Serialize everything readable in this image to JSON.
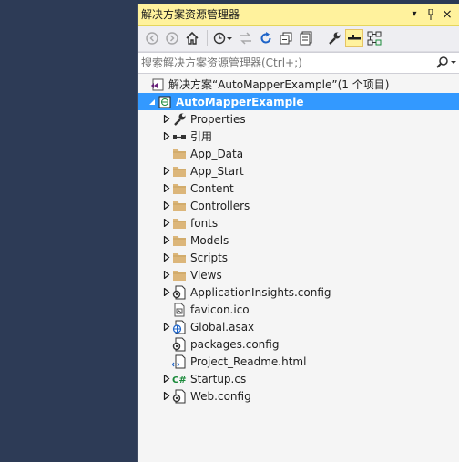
{
  "panel": {
    "title": "解决方案资源管理器",
    "controls": {
      "dropdown": "▾",
      "pin": "⊥",
      "close": "×"
    }
  },
  "toolbar": {
    "buttons": [
      "back-icon",
      "forward-icon",
      "home-icon",
      "history-icon",
      "sync-icon",
      "refresh-icon",
      "collapse-all-icon",
      "show-all-files-icon",
      "properties-icon",
      "preview-icon",
      "class-view-icon"
    ]
  },
  "search": {
    "placeholder": "搜索解决方案资源管理器(Ctrl+;)"
  },
  "tree": {
    "solution": "解决方案“AutoMapperExample”(1 个项目)",
    "project": "AutoMapperExample",
    "items": [
      {
        "label": "Properties",
        "icon": "wrench-icon",
        "expandable": true
      },
      {
        "label": "引用",
        "icon": "references-icon",
        "expandable": true
      },
      {
        "label": "App_Data",
        "icon": "folder-icon",
        "expandable": false
      },
      {
        "label": "App_Start",
        "icon": "folder-icon",
        "expandable": true
      },
      {
        "label": "Content",
        "icon": "folder-icon",
        "expandable": true
      },
      {
        "label": "Controllers",
        "icon": "folder-icon",
        "expandable": true
      },
      {
        "label": "fonts",
        "icon": "folder-icon",
        "expandable": true
      },
      {
        "label": "Models",
        "icon": "folder-icon",
        "expandable": true
      },
      {
        "label": "Scripts",
        "icon": "folder-icon",
        "expandable": true
      },
      {
        "label": "Views",
        "icon": "folder-icon",
        "expandable": true
      },
      {
        "label": "ApplicationInsights.config",
        "icon": "config-icon",
        "expandable": true
      },
      {
        "label": "favicon.ico",
        "icon": "image-file-icon",
        "expandable": false
      },
      {
        "label": "Global.asax",
        "icon": "globe-file-icon",
        "expandable": true
      },
      {
        "label": "packages.config",
        "icon": "config-icon",
        "expandable": false
      },
      {
        "label": "Project_Readme.html",
        "icon": "html-file-icon",
        "expandable": false
      },
      {
        "label": "Startup.cs",
        "icon": "csharp-file-icon",
        "expandable": true
      },
      {
        "label": "Web.config",
        "icon": "config-icon",
        "expandable": true
      }
    ]
  },
  "colors": {
    "titlebar": "#fff29d",
    "selection": "#3399ff",
    "folder": "#dcb67a",
    "background": "#2b3a55"
  }
}
